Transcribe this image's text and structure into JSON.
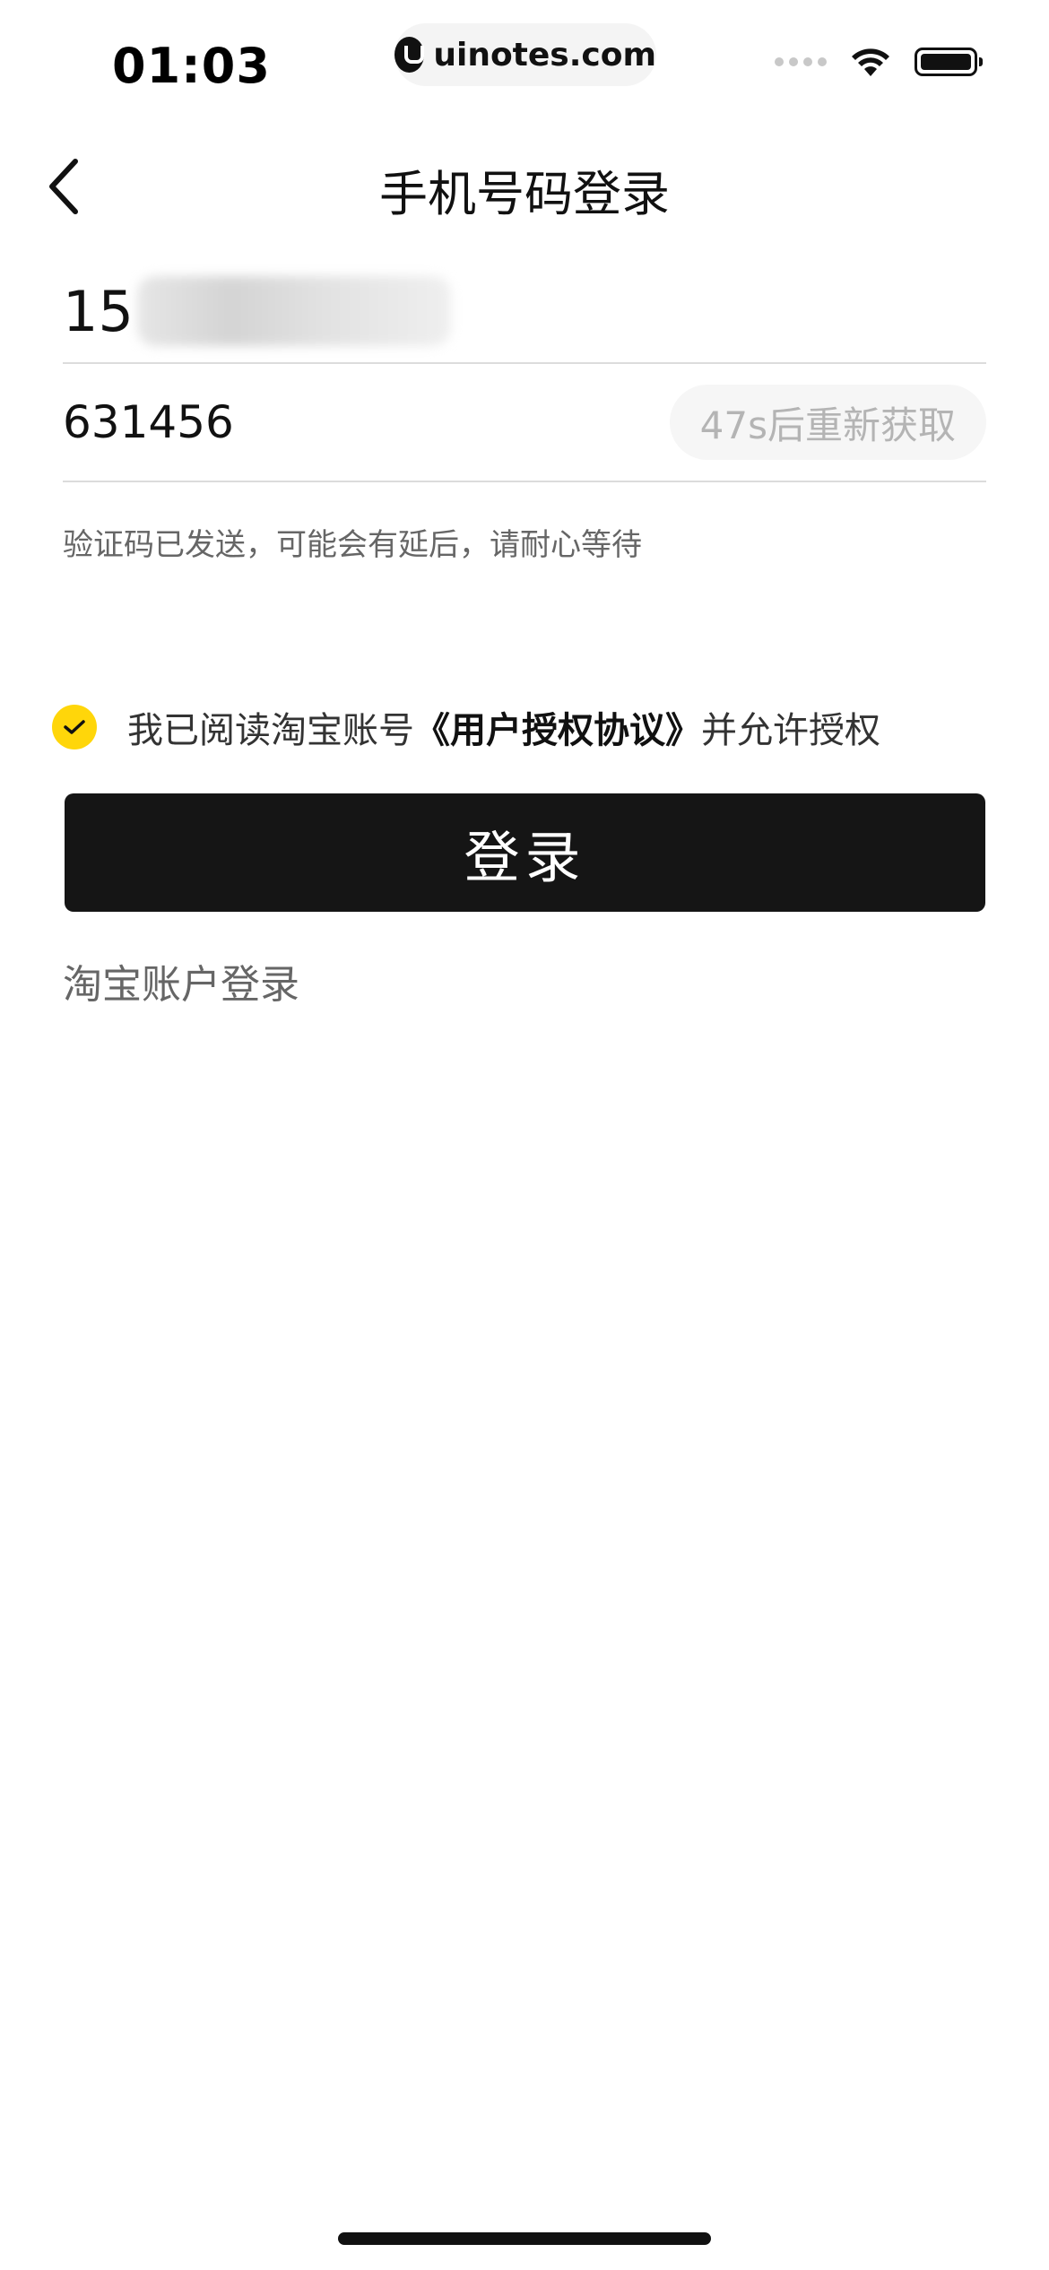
{
  "status_bar": {
    "time": "01:03",
    "url": "uinotes.com"
  },
  "nav": {
    "title": "手机号码登录"
  },
  "form": {
    "phone_visible_prefix": "15",
    "code_value": "631456",
    "resend_label": "47s后重新获取",
    "hint": "验证码已发送，可能会有延后，请耐心等待"
  },
  "agreement": {
    "prefix": "我已阅读淘宝账号",
    "link": "《用户授权协议》",
    "suffix": "并允许授权",
    "checked": true
  },
  "actions": {
    "login_label": "登录",
    "account_login_label": "淘宝账户登录"
  },
  "colors": {
    "accent_check": "#ffd60a",
    "button_bg": "#151515"
  }
}
